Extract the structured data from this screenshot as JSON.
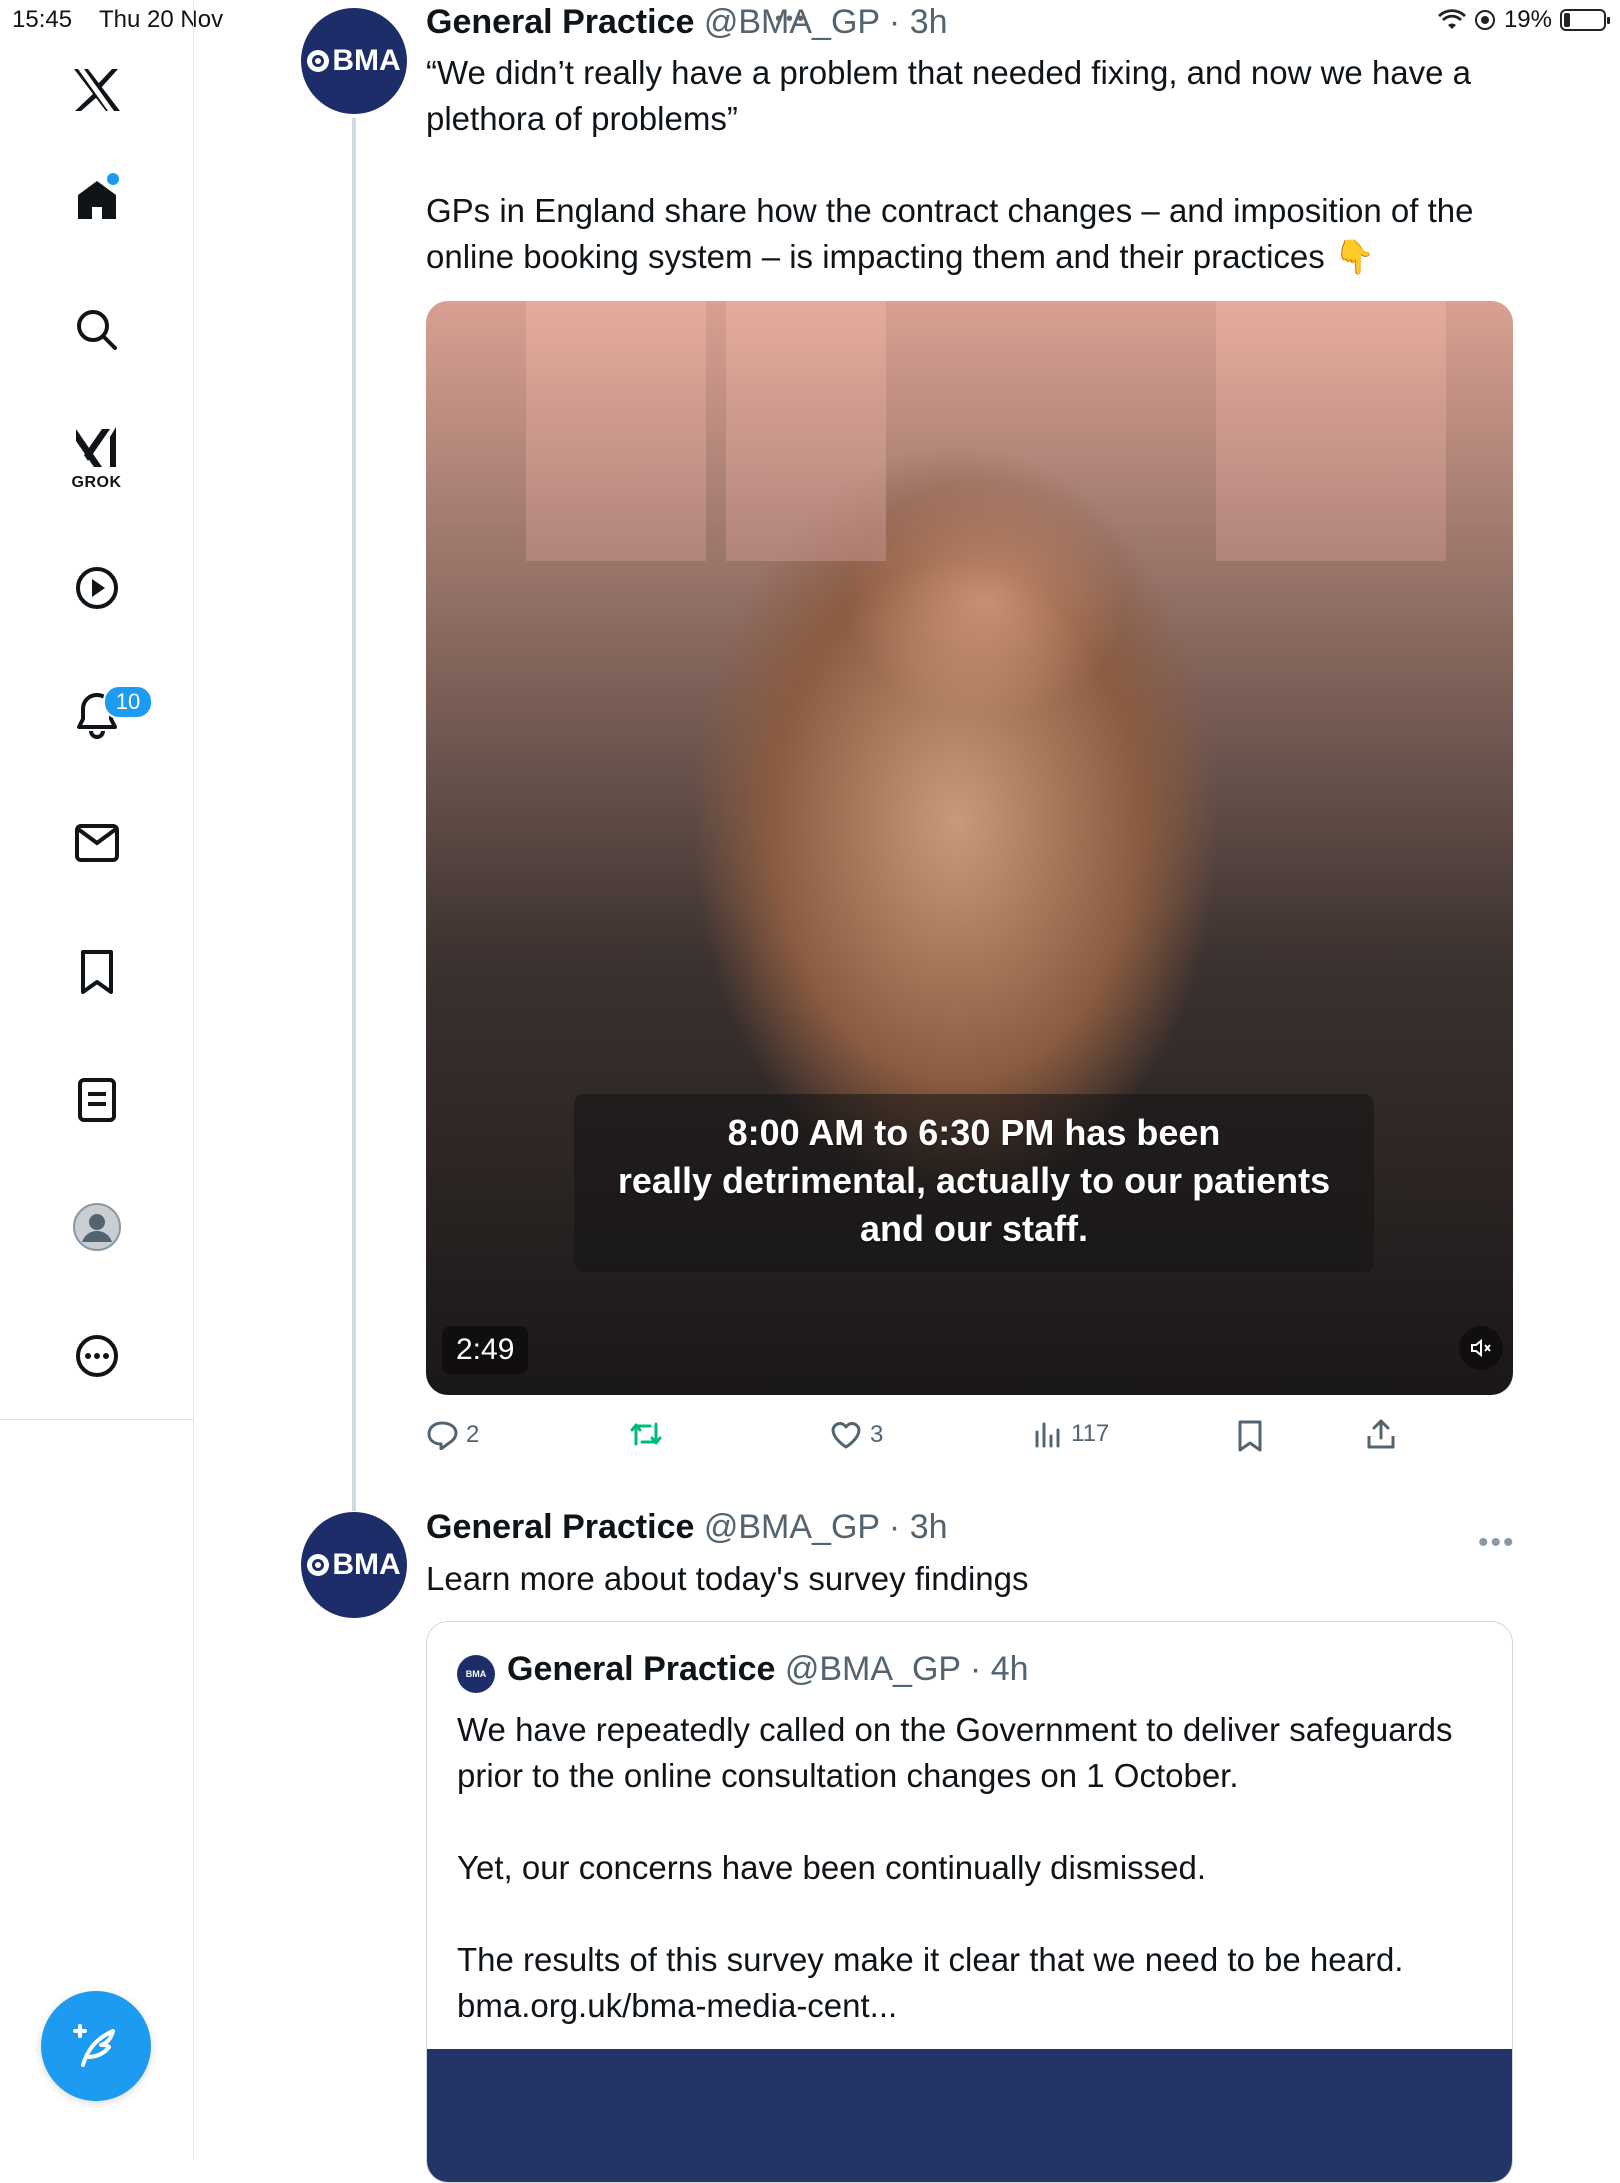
{
  "status_bar": {
    "time": "15:45",
    "date": "Thu 20 Nov",
    "battery": "19%"
  },
  "sidebar": {
    "grok_label": "GROK",
    "notifications_count": "10"
  },
  "posts": [
    {
      "avatar_text": "BMA",
      "name": "General Practice",
      "handle": "@BMA_GP",
      "time": "3h",
      "text": "“We didn’t really have a problem that needed fixing, and now we have a plethora of problems”\n\nGPs in England share how the contract changes – and imposition of the online booking system – is impacting them and their practices 👇",
      "video": {
        "caption": "8:00 AM to 6:30 PM has been\nreally detrimental, actually to our patients\nand our staff.",
        "duration": "2:49"
      },
      "actions": {
        "replies": "2",
        "likes": "3",
        "views": "117"
      }
    },
    {
      "avatar_text": "BMA",
      "name": "General Practice",
      "handle": "@BMA_GP",
      "time": "3h",
      "text": "Learn more about today's survey findings",
      "quote": {
        "avatar_text": "BMA",
        "name": "General Practice",
        "handle": "@BMA_GP",
        "time": "4h",
        "text": "We have repeatedly called on the Government to deliver safeguards prior to the online consultation changes on 1 October.\n\nYet, our concerns have been continually dismissed.\n\nThe results of this survey make it clear that we need to be heard. bma.org.uk/bma-media-cent..."
      }
    }
  ],
  "colors": {
    "accent": "#1d9bf0",
    "bma_navy": "#1c2d6a",
    "retweet_green": "#00ba7c"
  }
}
